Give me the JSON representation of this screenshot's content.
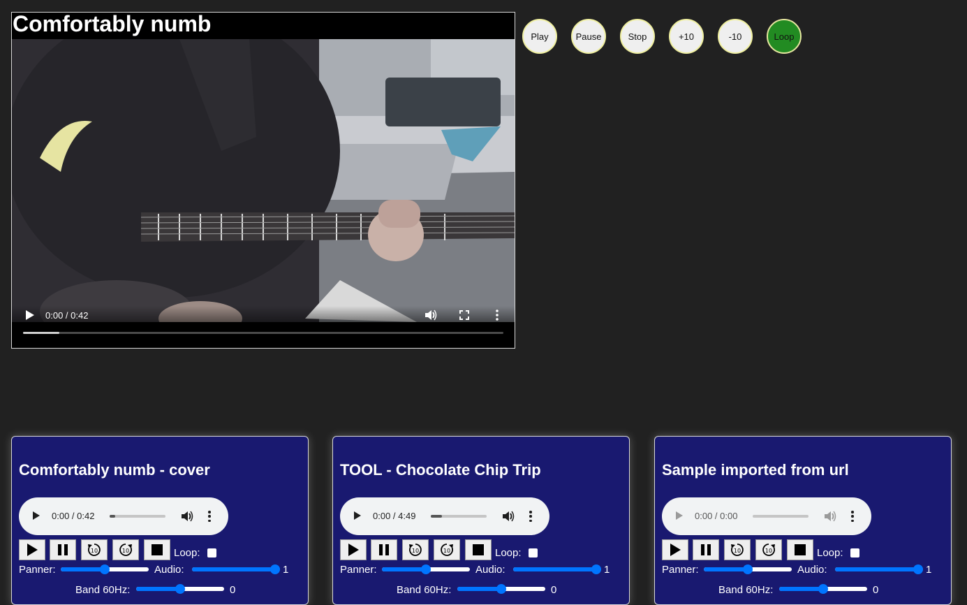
{
  "video": {
    "title": "Comfortably numb",
    "time": "0:00 / 0:42",
    "progress": 0.075
  },
  "controls": [
    {
      "label": "Play"
    },
    {
      "label": "Pause"
    },
    {
      "label": "Stop"
    },
    {
      "label": "+10"
    },
    {
      "label": "-10"
    },
    {
      "label": "Loop",
      "active_color": "#228b22"
    }
  ],
  "samples": [
    {
      "title": "Comfortably numb - cover",
      "audio_time": "0:00 / 0:42",
      "audio_progress": 0.1,
      "loop_label": "Loop:",
      "panner_label": "Panner:",
      "audio_label": "Audio:",
      "audio_value": "1",
      "band_label": "Band 60Hz:",
      "band_value": "0",
      "panner_level": 0.5,
      "audio_level": 1,
      "band_level": 0.5
    },
    {
      "title": "TOOL - Chocolate Chip Trip",
      "audio_time": "0:00 / 4:49",
      "audio_progress": 0.2,
      "loop_label": "Loop:",
      "panner_label": "Panner:",
      "audio_label": "Audio:",
      "audio_value": "1",
      "band_label": "Band 60Hz:",
      "band_value": "0",
      "panner_level": 0.5,
      "audio_level": 1,
      "band_level": 0.5
    },
    {
      "title": "Sample imported from url",
      "audio_time": "0:00 / 0:00",
      "audio_progress": 0,
      "loop_label": "Loop:",
      "panner_label": "Panner:",
      "audio_label": "Audio:",
      "audio_value": "1",
      "band_label": "Band 60Hz:",
      "band_value": "0",
      "panner_level": 0.5,
      "audio_level": 1,
      "band_level": 0.5
    }
  ]
}
